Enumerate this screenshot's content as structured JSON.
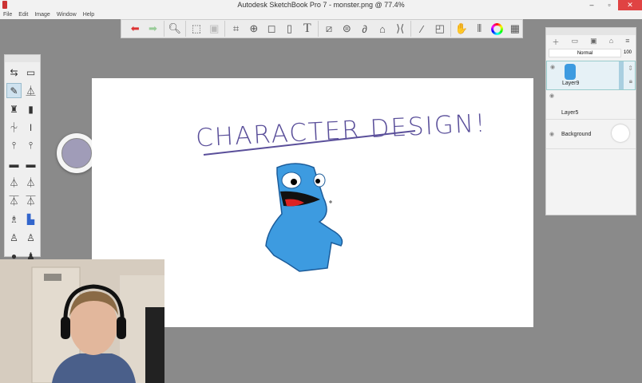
{
  "window": {
    "title": "Autodesk SketchBook Pro 7 - monster.png @ 77.4%",
    "minimize": "–",
    "maximize": "▫",
    "close": "✕"
  },
  "menu": [
    "File",
    "Edit",
    "Image",
    "Window",
    "Help"
  ],
  "canvas": {
    "heading": "CHARACTER DESIGN!"
  },
  "layers": {
    "blend_mode": "Normal",
    "opacity": "100",
    "items": [
      {
        "name": "Layer9"
      },
      {
        "name": "Layer5"
      },
      {
        "name": "Background"
      }
    ]
  },
  "colors": {
    "brush": "#a09cb8",
    "monster": "#3d9be0",
    "heading": "#5a4f9a"
  }
}
